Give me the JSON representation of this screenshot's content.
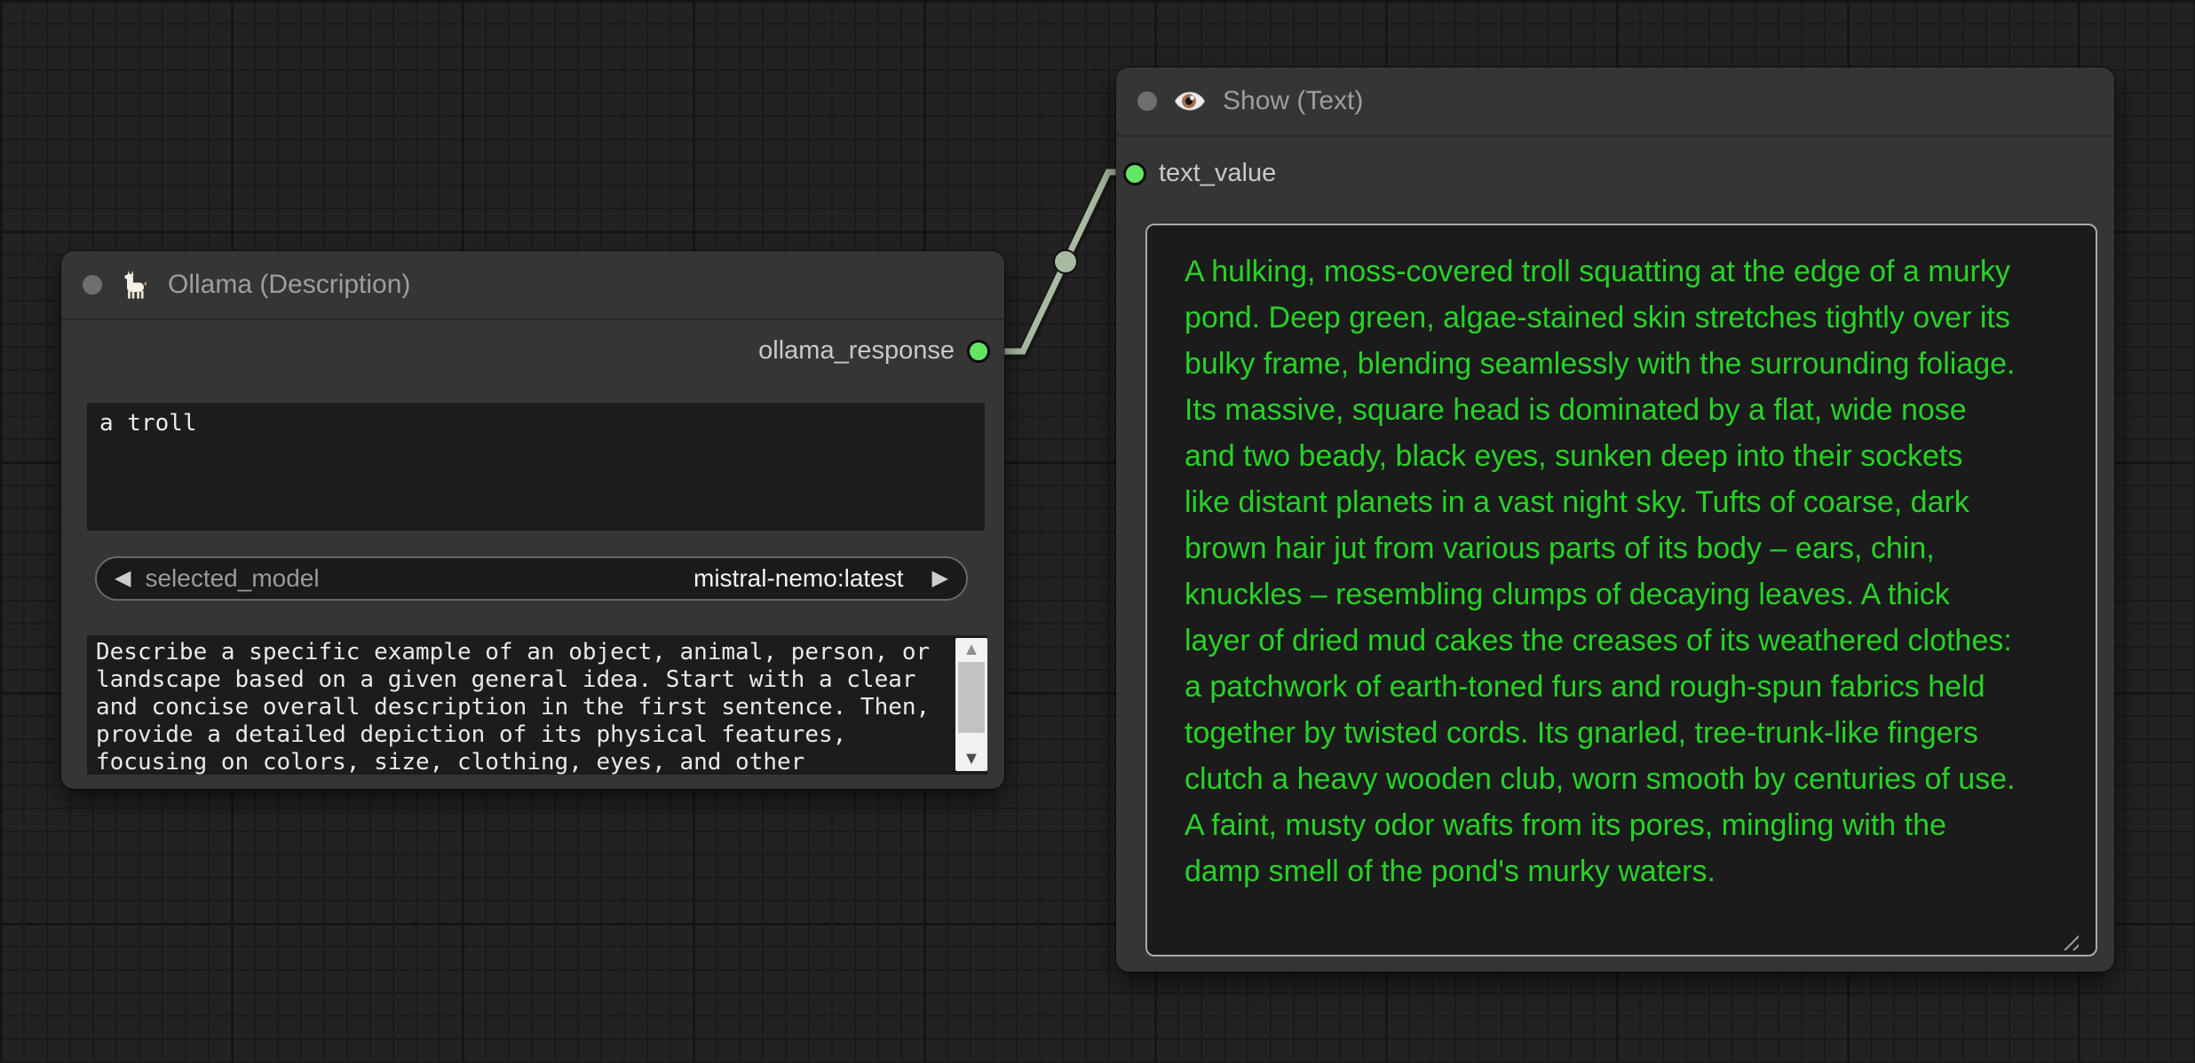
{
  "ollama_node": {
    "title": "Ollama (Description)",
    "icon": "llama-icon",
    "output_slot": {
      "label": "ollama_response"
    },
    "prompt_input": {
      "value": "a troll"
    },
    "model_selector": {
      "prev_arrow": "◀",
      "label": "selected_model",
      "value": "mistral-nemo:latest",
      "next_arrow": "▶"
    },
    "system_prompt": {
      "value": "Describe a specific example of an object, animal, person, or\nlandscape based on a given general idea. Start with a clear\nand concise overall description in the first sentence. Then,\nprovide a detailed depiction of its physical features,\nfocusing on colors, size, clothing, eyes, and other",
      "scrollbar_up_arrow": "▲",
      "scrollbar_down_arrow": "▼"
    }
  },
  "show_node": {
    "title": "Show (Text)",
    "icon": "eye-icon",
    "input_slot": {
      "label": "text_value"
    },
    "text_output": {
      "value": "A hulking, moss-covered troll squatting at the edge of a murky\npond. Deep green, algae-stained skin stretches tightly over its\nbulky frame, blending seamlessly with the surrounding foliage.\nIts massive, square head is dominated by a flat, wide nose\nand two beady, black eyes, sunken deep into their sockets\nlike distant planets in a vast night sky. Tufts of coarse, dark\nbrown hair jut from various parts of its body – ears, chin,\nknuckles – resembling clumps of decaying leaves. A thick\nlayer of dried mud cakes the creases of its weathered clothes:\na patchwork of earth-toned furs and rough-spun fabrics held\ntogether by twisted cords. Its gnarled, tree-trunk-like fingers\nclutch a heavy wooden club, worn smooth by centuries of use.\nA faint, musty odor wafts from its pores, mingling with the\ndamp smell of the pond's murky waters."
    }
  },
  "colors": {
    "canvas_bg": "#222222",
    "grid_line": "#1a1a1a",
    "node_bg": "#353535",
    "title_text": "#9e9e9e",
    "slot_green": "#63e563",
    "link": "#a8baa2",
    "response_text_green": "#28d228",
    "field_bg": "#1c1c1c"
  }
}
